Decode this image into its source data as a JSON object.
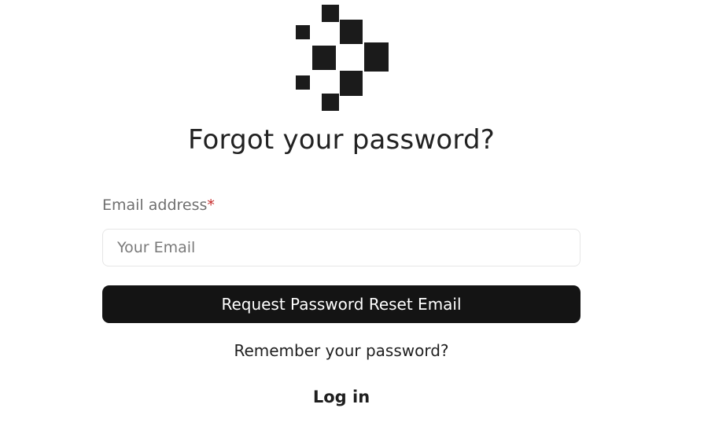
{
  "logo": {
    "icon": "pixel-arrow-logo-icon",
    "color": "#1b1b1b"
  },
  "page_title": "Forgot your password?",
  "form": {
    "email_label": "Email address",
    "required_marker": "*",
    "email_placeholder": "Your Email",
    "email_value": "",
    "submit_label": "Request Password Reset Email"
  },
  "footer": {
    "remember_text": "Remember your password?",
    "login_link": "Log in"
  },
  "colors": {
    "button_bg": "#141414",
    "button_text": "#ffffff",
    "required": "#c62828",
    "label": "#6f6f6f"
  }
}
